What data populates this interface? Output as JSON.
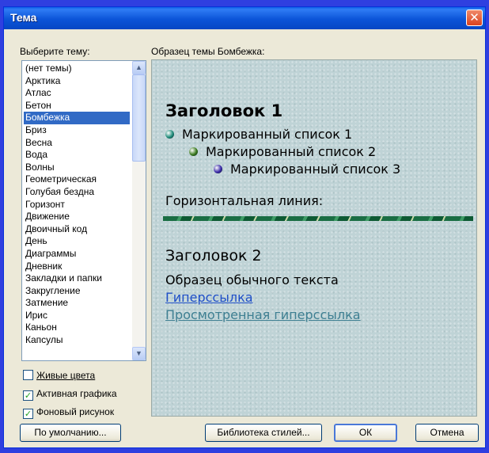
{
  "window": {
    "title": "Тема",
    "close_glyph": "✕"
  },
  "list": {
    "label": "Выберите тему:",
    "items": [
      "(нет темы)",
      "Арктика",
      "Атлас",
      "Бетон",
      "Бомбежка",
      "Бриз",
      "Весна",
      "Вода",
      "Волны",
      "Геометрическая",
      "Голубая бездна",
      "Горизонт",
      "Движение",
      "Двоичный код",
      "День",
      "Диаграммы",
      "Дневник",
      "Закладки и папки",
      "Закругление",
      "Затмение",
      "Ирис",
      "Каньон",
      "Капсулы"
    ],
    "selected": "Бомбежка",
    "scroll_up_icon": "▲",
    "scroll_down_icon": "▼"
  },
  "options": {
    "vivid_colors": {
      "label": "Живые цвета",
      "checked": false
    },
    "active_graphics": {
      "label": "Активная графика",
      "checked": true
    },
    "background_image": {
      "label": "Фоновый рисунок",
      "checked": true
    }
  },
  "buttons": {
    "default": "По умолчанию...",
    "style_gallery": "Библиотека стилей...",
    "ok": "ОК",
    "cancel": "Отмена"
  },
  "preview": {
    "label": "Образец темы Бомбежка:",
    "heading1": "Заголовок 1",
    "bullet1": "Маркированный список 1",
    "bullet2": "Маркированный список 2",
    "bullet3": "Маркированный список 3",
    "hr_label": "Горизонтальная линия:",
    "heading2": "Заголовок 2",
    "normal_text": "Образец обычного текста",
    "hyperlink": "Гиперссылка",
    "visited_link": "Просмотренная гиперссылка",
    "bullet_colors": [
      "#1e8c7a",
      "#3a7a1e",
      "#3a2aa8"
    ],
    "check_glyph": "✓"
  }
}
